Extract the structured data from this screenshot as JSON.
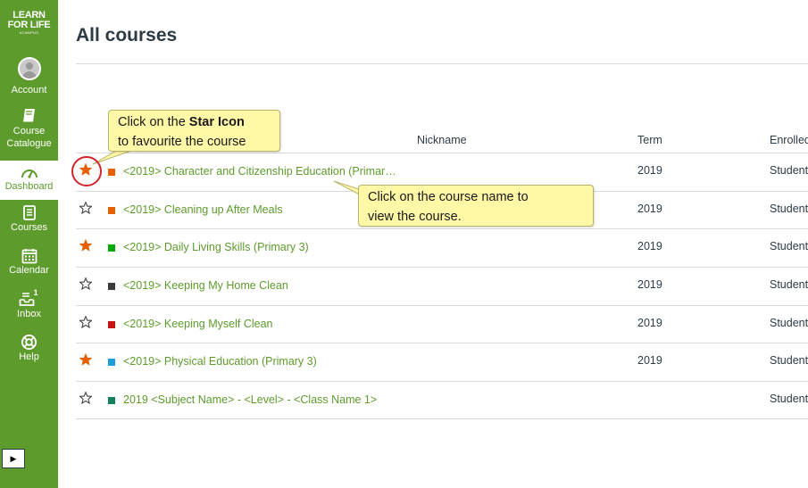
{
  "sidebar": {
    "logo": {
      "line1": "LEARN",
      "line2": "FOR LIFE",
      "line3": "eCAMPUS"
    },
    "items": [
      {
        "label": "Account",
        "icon": "avatar-icon"
      },
      {
        "label": "Course Catalogue",
        "icon": "book-icon"
      },
      {
        "label": "Dashboard",
        "icon": "speedometer-icon",
        "active": true
      },
      {
        "label": "Courses",
        "icon": "courses-icon"
      },
      {
        "label": "Calendar",
        "icon": "calendar-icon"
      },
      {
        "label": "Inbox",
        "icon": "inbox-icon",
        "badge": "1"
      },
      {
        "label": "Help",
        "icon": "lifebuoy-icon"
      }
    ],
    "collapse_glyph": "▶"
  },
  "page": {
    "title": "All courses"
  },
  "table": {
    "headers": {
      "nickname": "Nickname",
      "term": "Term",
      "enrolled": "Enrolled"
    },
    "rows": [
      {
        "favorite": true,
        "color": "#e66000",
        "name": "<2019> Character and Citizenship Education (Primar…",
        "term": "2019",
        "enrolled": "Student"
      },
      {
        "favorite": false,
        "color": "#e66000",
        "name": "<2019> Cleaning up After Meals",
        "term": "2019",
        "enrolled": "Student"
      },
      {
        "favorite": true,
        "color": "#00aa00",
        "name": "<2019> Daily Living Skills (Primary 3)",
        "term": "2019",
        "enrolled": "Student"
      },
      {
        "favorite": false,
        "color": "#3b3b3b",
        "name": "<2019> Keeping My Home Clean",
        "term": "2019",
        "enrolled": "Student"
      },
      {
        "favorite": false,
        "color": "#cc1111",
        "name": "<2019> Keeping Myself Clean",
        "term": "2019",
        "enrolled": "Student"
      },
      {
        "favorite": true,
        "color": "#1b9ddb",
        "name": "<2019> Physical Education (Primary 3)",
        "term": "2019",
        "enrolled": "Student"
      },
      {
        "favorite": false,
        "color": "#12805c",
        "name": "2019 <Subject Name> - <Level> - <Class Name 1>",
        "term": "",
        "enrolled": "Student"
      }
    ]
  },
  "callouts": {
    "star": {
      "prefix": "Click on the ",
      "bold": "Star Icon",
      "line2": "to favourite the course"
    },
    "course": {
      "line1": "Click on the course name to",
      "line2": "view the course."
    }
  },
  "colors": {
    "brand": "#5e9b2d",
    "star": "#e66000",
    "callout_bg": "#fff8a6",
    "highlight": "#d2262b"
  }
}
